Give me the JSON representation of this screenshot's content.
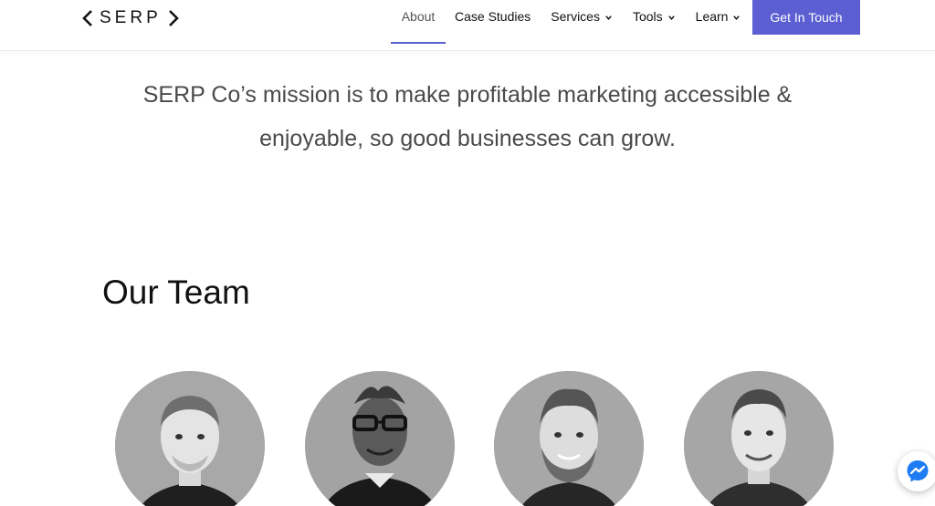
{
  "header": {
    "logo_text": "SERP",
    "nav": [
      {
        "label": "About",
        "active": true,
        "dropdown": false
      },
      {
        "label": "Case Studies",
        "active": false,
        "dropdown": false
      },
      {
        "label": "Services",
        "active": false,
        "dropdown": true
      },
      {
        "label": "Tools",
        "active": false,
        "dropdown": true
      },
      {
        "label": "Learn",
        "active": false,
        "dropdown": true
      }
    ],
    "cta_label": "Get In Touch"
  },
  "mission": {
    "line1": "SERP Co’s mission is to make profitable marketing accessible &",
    "line2": "enjoyable, so good businesses can grow."
  },
  "team": {
    "title": "Our Team",
    "members": [
      {
        "photo": "team-member-photo"
      },
      {
        "photo": "team-member-photo"
      },
      {
        "photo": "team-member-photo"
      },
      {
        "photo": "team-member-photo"
      }
    ]
  },
  "colors": {
    "accent": "#5b5fd1",
    "text": "#111111",
    "mission_text": "#4a4a4a",
    "messenger_blue": "#1e7cf2"
  },
  "icons": {
    "messenger": "messenger-icon",
    "caret": "chevron-down-icon"
  }
}
